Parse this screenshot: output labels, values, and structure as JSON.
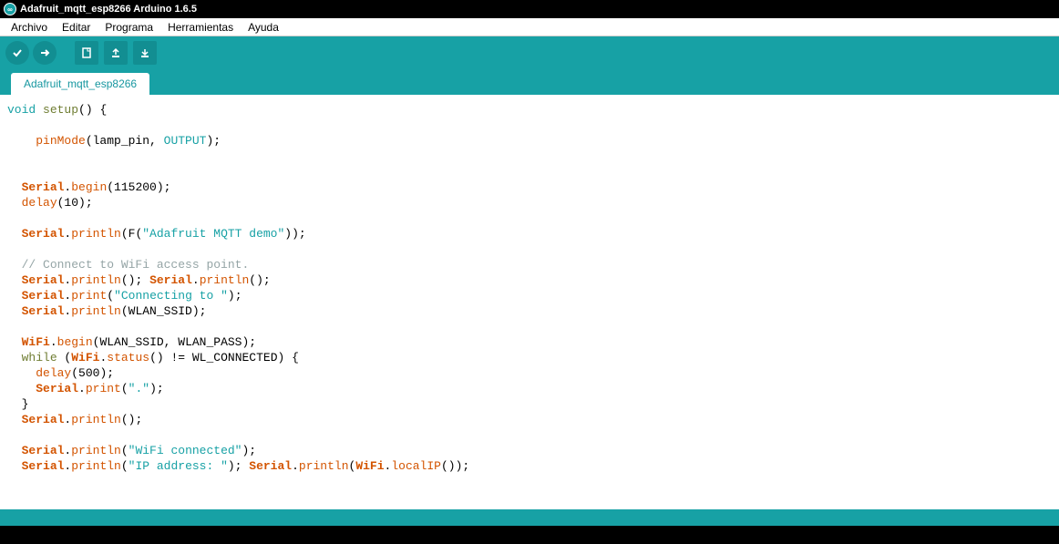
{
  "window": {
    "title": "Adafruit_mqtt_esp8266 Arduino 1.6.5"
  },
  "menu": {
    "file": "Archivo",
    "edit": "Editar",
    "sketch": "Programa",
    "tools": "Herramientas",
    "help": "Ayuda"
  },
  "tab": {
    "name": "Adafruit_mqtt_esp8266"
  },
  "code": {
    "l1_void": "void",
    "l1_setup": "setup",
    "l1_rest": "() {",
    "l2_pinmode": "pinMode",
    "l2_args": "(lamp_pin, ",
    "l2_output": "OUTPUT",
    "l2_end": ");",
    "l3_serial": "Serial",
    "l3_dot": ".",
    "l3_begin": "begin",
    "l3_args": "(115200);",
    "l4_delay": "delay",
    "l4_args": "(10);",
    "l5_serial": "Serial",
    "l5_println": "println",
    "l5_f": "(F(",
    "l5_str": "\"Adafruit MQTT demo\"",
    "l5_end": "));",
    "l6_comment": "// Connect to WiFi access point.",
    "l7_serial": "Serial",
    "l7_println": "println",
    "l7_args": "(); ",
    "l7b_serial": "Serial",
    "l7b_println": "println",
    "l7b_args": "();",
    "l8_serial": "Serial",
    "l8_print": "print",
    "l8_open": "(",
    "l8_str": "\"Connecting to \"",
    "l8_end": ");",
    "l9_serial": "Serial",
    "l9_println": "println",
    "l9_args": "(WLAN_SSID);",
    "l10_wifi": "WiFi",
    "l10_begin": "begin",
    "l10_args": "(WLAN_SSID, WLAN_PASS);",
    "l11_while": "while",
    "l11_open": " (",
    "l11_wifi": "WiFi",
    "l11_status": "status",
    "l11_rest": "() != WL_CONNECTED) {",
    "l12_delay": "delay",
    "l12_args": "(500);",
    "l13_serial": "Serial",
    "l13_print": "print",
    "l13_open": "(",
    "l13_str": "\".\"",
    "l13_end": ");",
    "l14_brace": "}",
    "l15_serial": "Serial",
    "l15_println": "println",
    "l15_args": "();",
    "l16_serial": "Serial",
    "l16_println": "println",
    "l16_open": "(",
    "l16_str": "\"WiFi connected\"",
    "l16_end": ");",
    "l17_serial": "Serial",
    "l17_println": "println",
    "l17_open": "(",
    "l17_str": "\"IP address: \"",
    "l17_end": "); ",
    "l17b_serial": "Serial",
    "l17b_println": "println",
    "l17b_open": "(",
    "l17b_wifi": "WiFi",
    "l17b_localip": "localIP",
    "l17b_end": "());"
  }
}
